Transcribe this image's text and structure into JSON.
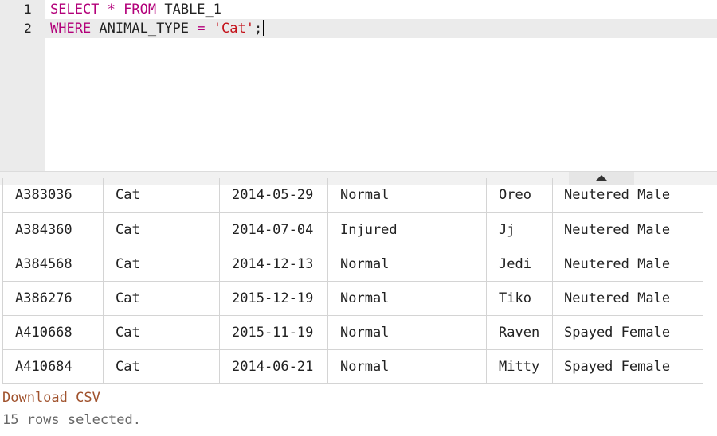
{
  "editor": {
    "lines": [
      {
        "number": "1",
        "tokens": [
          {
            "t": "kw",
            "v": "SELECT"
          },
          {
            "t": "plain",
            "v": " "
          },
          {
            "t": "op",
            "v": "*"
          },
          {
            "t": "plain",
            "v": " "
          },
          {
            "t": "kw",
            "v": "FROM"
          },
          {
            "t": "plain",
            "v": " TABLE_1"
          }
        ]
      },
      {
        "number": "2",
        "tokens": [
          {
            "t": "kw",
            "v": "WHERE"
          },
          {
            "t": "plain",
            "v": " ANIMAL_TYPE "
          },
          {
            "t": "op",
            "v": "="
          },
          {
            "t": "plain",
            "v": " "
          },
          {
            "t": "str",
            "v": "'Cat'"
          },
          {
            "t": "plain",
            "v": ";"
          }
        ]
      }
    ],
    "colors": {
      "keyword": "#b3007a",
      "string": "#c4121a",
      "active_line": "#ebebeb"
    }
  },
  "results": {
    "rows": [
      [
        "A383036",
        "Cat",
        "2014-05-29",
        "Normal",
        "Oreo",
        "Neutered Male"
      ],
      [
        "A384360",
        "Cat",
        "2014-07-04",
        "Injured",
        "Jj",
        "Neutered Male"
      ],
      [
        "A384568",
        "Cat",
        "2014-12-13",
        "Normal",
        "Jedi",
        "Neutered Male"
      ],
      [
        "A386276",
        "Cat",
        "2015-12-19",
        "Normal",
        "Tiko",
        "Neutered Male"
      ],
      [
        "A410668",
        "Cat",
        "2015-11-19",
        "Normal",
        "Raven",
        "Spayed Female"
      ],
      [
        "A410684",
        "Cat",
        "2014-06-21",
        "Normal",
        "Mitty",
        "Spayed Female"
      ]
    ]
  },
  "splitter": {
    "icon": "chevron-up-icon"
  },
  "footer": {
    "download_label": "Download CSV",
    "status": "15 rows selected."
  }
}
